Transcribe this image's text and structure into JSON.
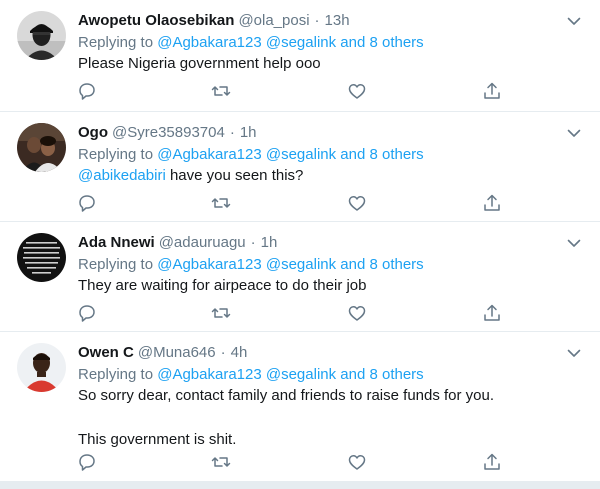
{
  "tweets": [
    {
      "name": "Awopetu Olaosebikan",
      "handle": "@ola_posi",
      "separator": "·",
      "time": "13h",
      "replying_prefix": "Replying to ",
      "replying_mentions": "@Agbakara123 @segalink and 8 others",
      "body": [
        "Please Nigeria government help ooo"
      ],
      "avatar_icon": "avatar-photo-man-in-cap"
    },
    {
      "name": "Ogo",
      "handle": "@Syre35893704",
      "separator": "·",
      "time": "1h",
      "replying_prefix": "Replying to ",
      "replying_mentions": "@Agbakara123 @segalink and 8 others",
      "body_mention": "@abikedabiri",
      "body_rest": " have you seen this?",
      "avatar_icon": "avatar-photo-couple"
    },
    {
      "name": "Ada Nnewi",
      "handle": "@adauruagu",
      "separator": "·",
      "time": "1h",
      "replying_prefix": "Replying to ",
      "replying_mentions": "@Agbakara123 @segalink and 8 others",
      "body": [
        "They are waiting for airpeace to do their job"
      ],
      "avatar_icon": "avatar-quote-text-image"
    },
    {
      "name": "Owen C",
      "handle": "@Muna646",
      "separator": "·",
      "time": "4h",
      "replying_prefix": "Replying to ",
      "replying_mentions": "@Agbakara123 @segalink and 8 others",
      "body": [
        "So sorry dear, contact family and friends to raise funds for you.",
        "This government is shit."
      ],
      "avatar_icon": "avatar-photo-man-red-shirt"
    }
  ],
  "icons": {
    "caret": "chevron-down-icon",
    "reply": "reply-icon",
    "retweet": "retweet-icon",
    "like": "heart-icon",
    "share": "share-icon"
  },
  "colors": {
    "accent": "#1da1f2",
    "secondary_text": "#657786",
    "primary_text": "#14171a",
    "divider": "#e6ecf0"
  }
}
